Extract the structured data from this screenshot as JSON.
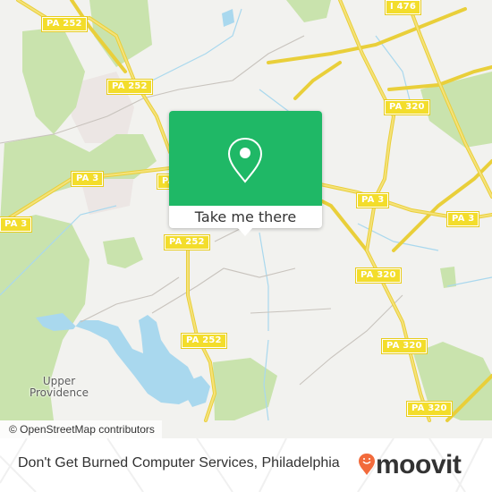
{
  "map": {
    "road_shields": [
      {
        "label": "PA 252"
      },
      {
        "label": "PA 252"
      },
      {
        "label": "I 476"
      },
      {
        "label": "PA 320"
      },
      {
        "label": "PA 3"
      },
      {
        "label": "PA 3"
      },
      {
        "label": "PA 3"
      },
      {
        "label": "PA 3"
      },
      {
        "label": "PA 3"
      },
      {
        "label": "PA 252"
      },
      {
        "label": "PA 320"
      },
      {
        "label": "PA 252"
      },
      {
        "label": "PA 320"
      },
      {
        "label": "PA 320"
      }
    ],
    "place_label": "Upper\nProvidence",
    "attribution": "© OpenStreetMap contributors",
    "colors": {
      "land": "#f2f2ef",
      "park": "#c9e3ad",
      "water": "#a9d8ee",
      "road": "#f5de5a",
      "residential": "#ece6e4"
    }
  },
  "popup": {
    "icon": "map-pin-icon",
    "button_label": "Take me there",
    "accent_color": "#1fb866"
  },
  "footer": {
    "title": "Don't Get Burned Computer Services, Philadelphia",
    "brand": "moovit",
    "brand_color": "#f26a3b"
  }
}
